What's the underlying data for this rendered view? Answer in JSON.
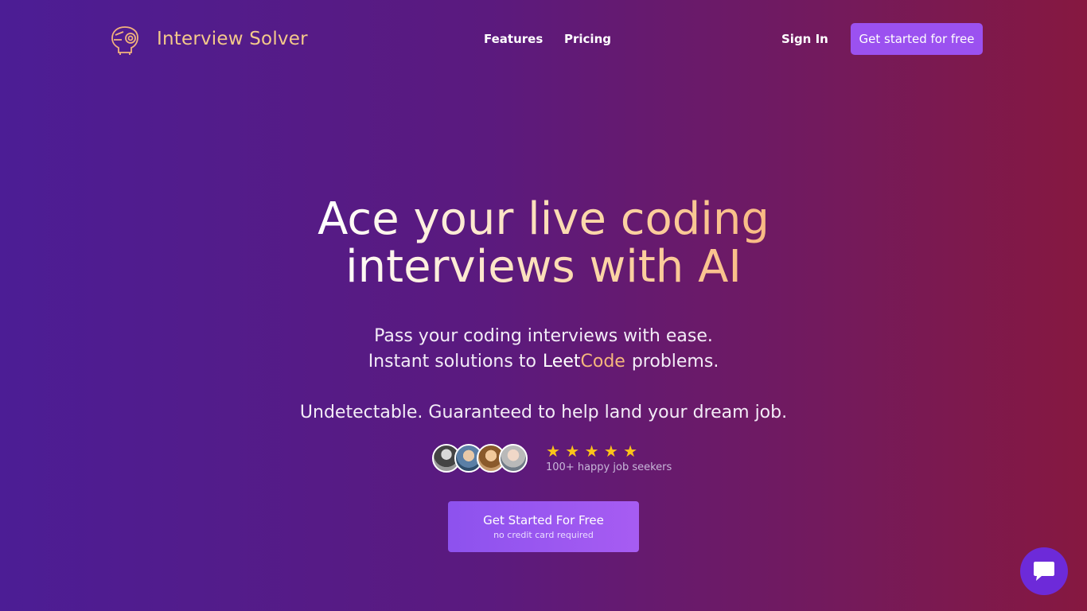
{
  "brand": {
    "name": "Interview Solver"
  },
  "nav": {
    "features": "Features",
    "pricing": "Pricing",
    "sign_in": "Sign In",
    "cta": "Get started for free"
  },
  "hero": {
    "headline_line1": "Ace your live coding",
    "headline_line2": "interviews with AI",
    "sub1": "Pass your coding interviews with ease.",
    "sub2_prefix": "Instant solutions to",
    "sub2_leet": "Leet",
    "sub2_code": "Code",
    "sub2_suffix": "problems.",
    "sub3": "Undetectable. Guaranteed to help land your dream job."
  },
  "proof": {
    "stars": "★ ★ ★ ★ ★",
    "text": "100+ happy job seekers"
  },
  "cta_main": {
    "label": "Get Started For Free",
    "note": "no credit card required"
  },
  "icons": {
    "logo": "robot-head-icon",
    "chat": "chat-bubble-icon"
  },
  "colors": {
    "accent": "#9b51f0",
    "headline_gold": "#f8b27a",
    "star": "#fcc419"
  }
}
